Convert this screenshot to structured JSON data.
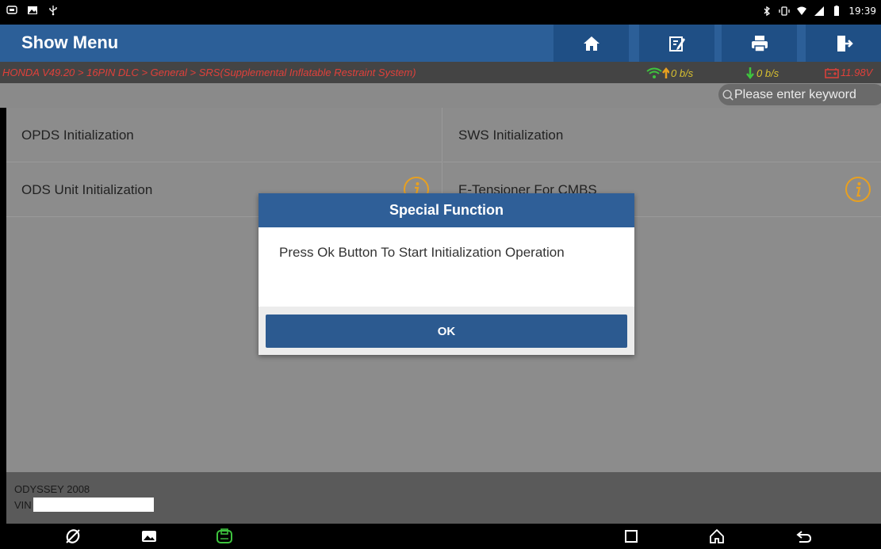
{
  "statusbar": {
    "time": "19:39",
    "left_icons": [
      "vci-icon",
      "image-icon",
      "usb-icon"
    ],
    "right_icons": [
      "bluetooth-icon",
      "vibrate-icon",
      "wifi-icon",
      "signal-icon",
      "battery-icon"
    ]
  },
  "header": {
    "title": "Show Menu",
    "buttons": [
      "home-icon",
      "edit-report-icon",
      "print-icon",
      "exit-icon"
    ]
  },
  "breadcrumb": {
    "path": "HONDA V49.20 > 16PIN DLC > General > SRS(Supplemental Inflatable Restraint System)",
    "upload": "0 b/s",
    "download": "0 b/s",
    "voltage": "11.98V"
  },
  "search": {
    "placeholder": "Please enter keyword"
  },
  "menu": {
    "items": [
      {
        "label": "OPDS Initialization",
        "info": false
      },
      {
        "label": "SWS Initialization",
        "info": false
      },
      {
        "label": "ODS Unit Initialization",
        "info": true
      },
      {
        "label": "E-Tensioner For CMBS",
        "info": true
      }
    ]
  },
  "footer": {
    "model": "ODYSSEY 2008",
    "vin_label": "VIN"
  },
  "dialog": {
    "title": "Special Function",
    "message": "Press Ok Button To Start Initialization Operation",
    "ok_label": "OK"
  },
  "navbar": {
    "icons": [
      "browser-icon",
      "gallery-icon",
      "vci-app-icon",
      "recents-icon",
      "home-nav-icon",
      "back-icon"
    ]
  },
  "colors": {
    "header_bg": "#2c5f98",
    "header_button_bg": "#1f4f85",
    "breadcrumb_text": "#e0403a",
    "stats_text": "#d8c030",
    "info_icon": "#e8a020",
    "dialog_button": "#2c5a90"
  }
}
